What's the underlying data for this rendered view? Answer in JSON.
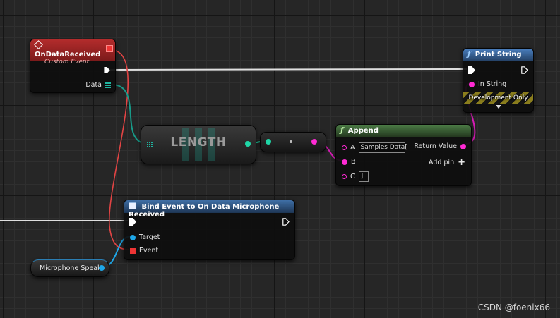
{
  "nodes": {
    "on_data_received": {
      "title": "OnDataReceived",
      "subtitle": "Custom Event",
      "data_pin": "Data"
    },
    "print_string": {
      "title": "Print String",
      "in_string": "In String",
      "dev_only": "Development Only"
    },
    "length": {
      "title": "LENGTH"
    },
    "append": {
      "title": "Append",
      "pin_a": "A",
      "pin_a_value": "Samples Data[",
      "pin_b": "B",
      "pin_c": "C",
      "pin_c_value": "]",
      "return_value": "Return Value",
      "add_pin": "Add pin",
      "add_pin_symbol": "+"
    },
    "bind_event": {
      "title": "Bind Event to On Data Microphone Received",
      "target": "Target",
      "event": "Event"
    },
    "microphone_var": {
      "label": "Microphone Speak"
    }
  },
  "icons": {
    "event": "diamond-event-icon",
    "function": "f",
    "delegate": "delegate-square-icon",
    "reroute": "reroute-dot"
  },
  "colors": {
    "event_header": "#a32828",
    "function_header": "#3f6fa6",
    "pure_function_header": "#3b6b3b",
    "exec_wire": "#e0e0e0",
    "string_pin": "#ff2ad4",
    "int_pin": "#1fd6a6",
    "array_pin": "#1fb5a0",
    "object_pin": "#1ea7e8",
    "delegate_pin": "#ee3434"
  },
  "watermark": "CSDN @foenix66"
}
